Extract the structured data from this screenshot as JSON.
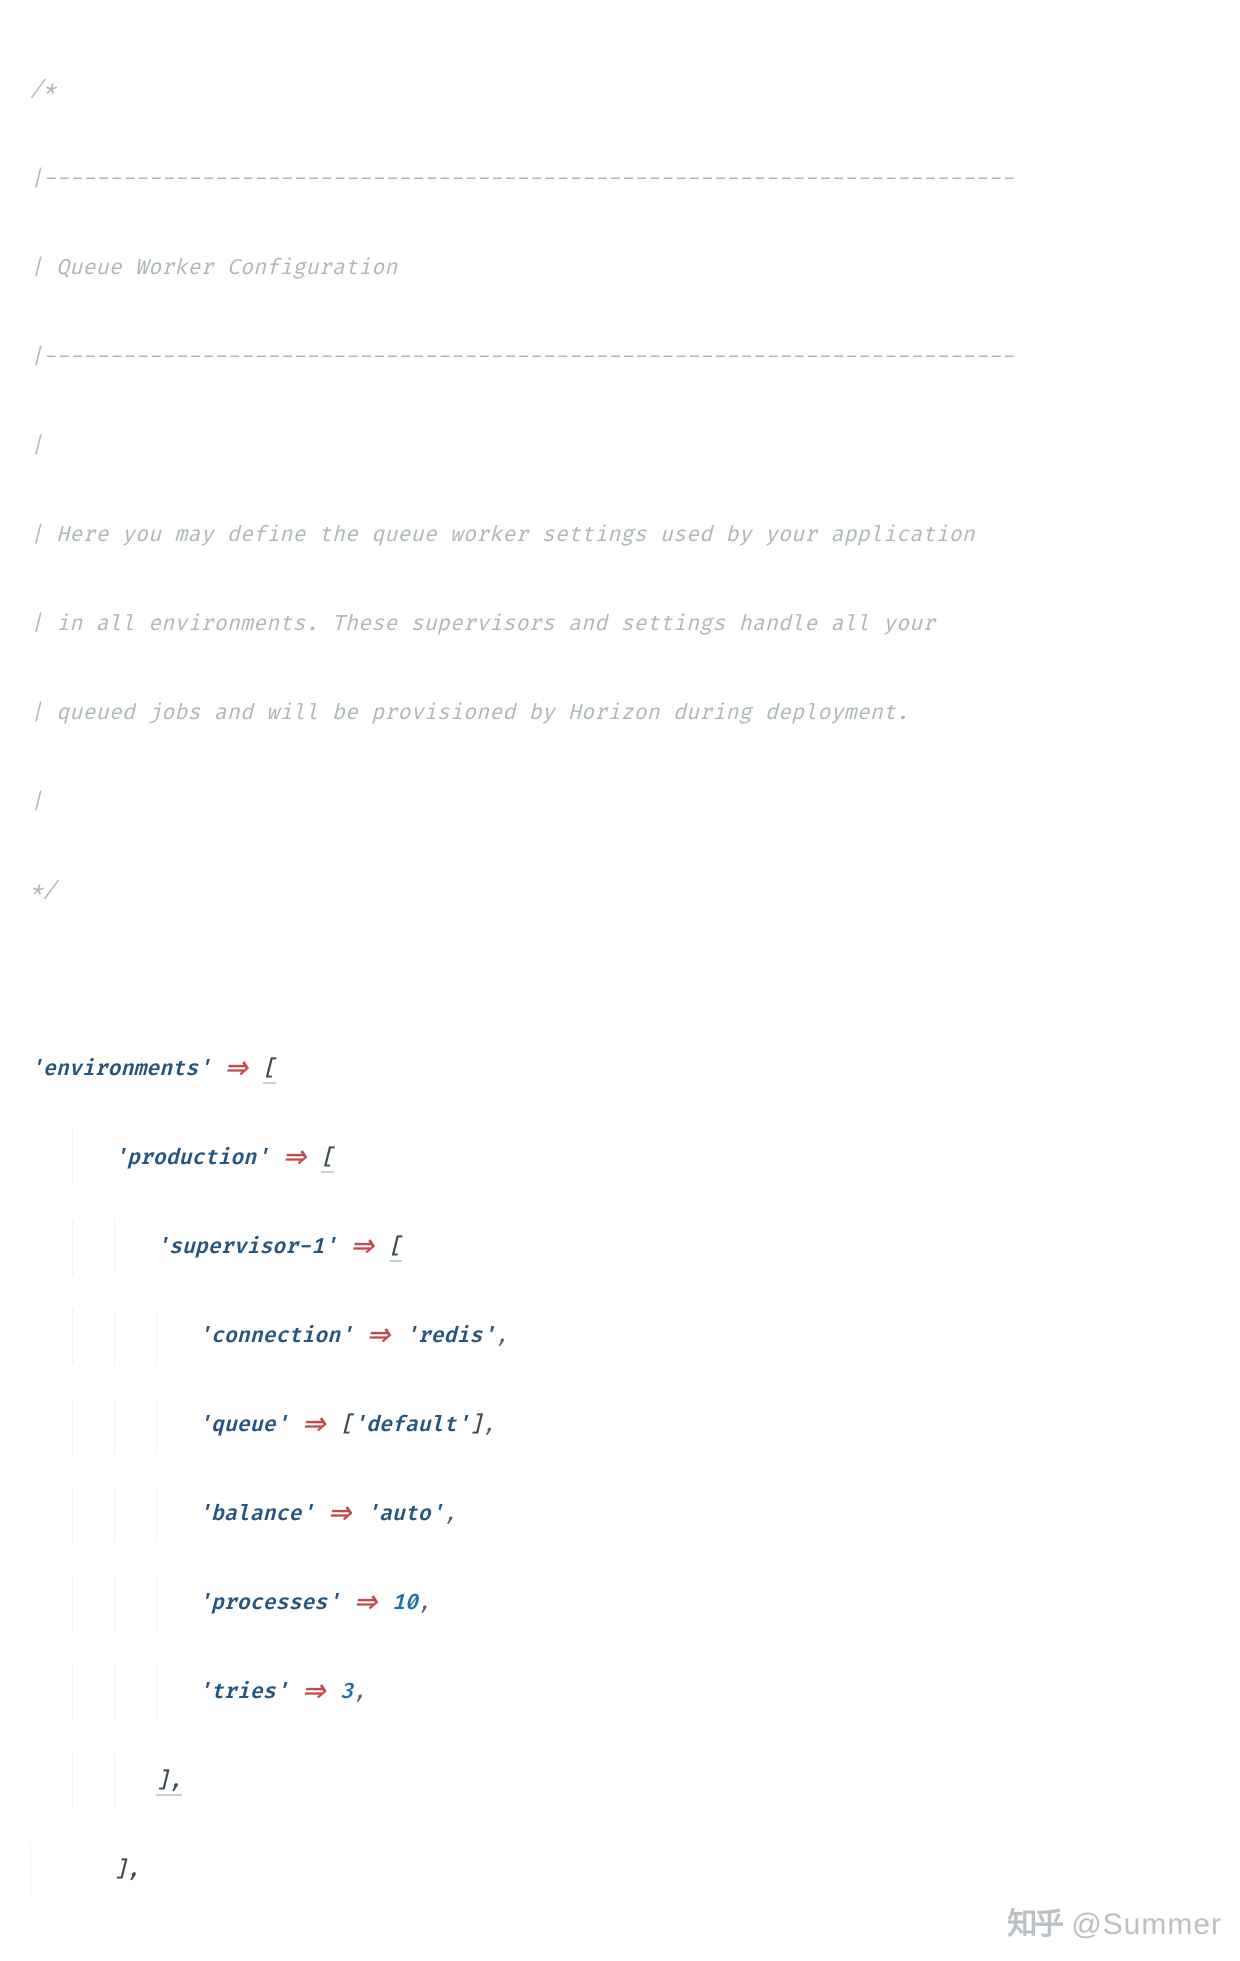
{
  "comment": {
    "open": "/*",
    "rule": "|--------------------------------------------------------------------------",
    "title": "| Queue Worker Configuration",
    "blank": "|",
    "l1": "| Here you may define the queue worker settings used by your application",
    "l2": "| in all environments. These supervisors and settings handle all your",
    "l3": "| queued jobs and will be provisioned by Horizon during deployment.",
    "close": "*/"
  },
  "code": {
    "environments_key": "'environments'",
    "arrow": "=>",
    "open_bracket": "[",
    "close_bracket_comma": "],",
    "production_key": "'production'",
    "supervisor_key": "'supervisor-1'",
    "entries": {
      "connection": {
        "key": "'connection'",
        "value": "'redis'"
      },
      "queue": {
        "key": "'queue'",
        "value_open": "[",
        "value_string": "'default'",
        "value_close": "]"
      },
      "balance": {
        "key": "'balance'",
        "value": "'auto'"
      },
      "processes": {
        "key": "'processes'",
        "value": "10"
      },
      "tries": {
        "key": "'tries'",
        "value": "3"
      }
    },
    "comma": ","
  },
  "watermark": {
    "logo": "知乎",
    "handle": "@Summer"
  }
}
